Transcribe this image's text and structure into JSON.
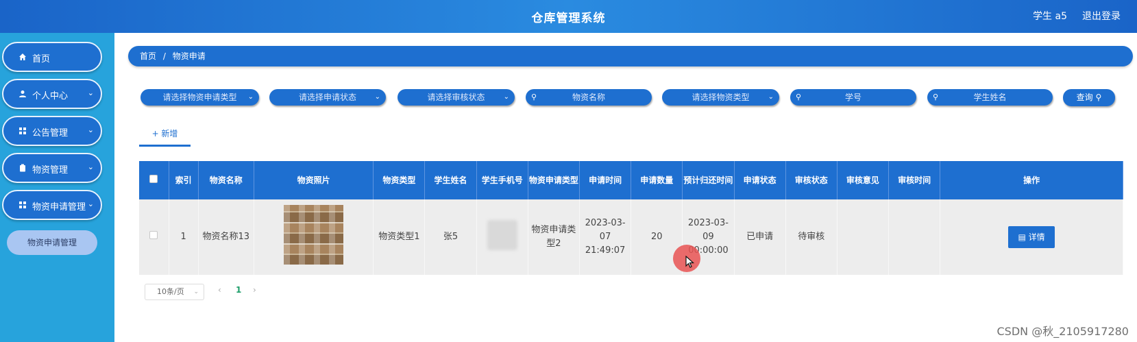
{
  "header": {
    "title": "仓库管理系统",
    "user": "学生 a5",
    "logout": "退出登录"
  },
  "sidebar": {
    "items": [
      {
        "label": "首页",
        "icon": "home-icon",
        "chevron": ""
      },
      {
        "label": "个人中心",
        "icon": "user-icon",
        "chevron": "⌄"
      },
      {
        "label": "公告管理",
        "icon": "grid-icon",
        "chevron": "⌄"
      },
      {
        "label": "物资管理",
        "icon": "clipboard-icon",
        "chevron": "⌄"
      },
      {
        "label": "物资申请管理",
        "icon": "grid-icon",
        "chevron": "⌄"
      }
    ],
    "sub_item": "物资申请管理"
  },
  "breadcrumb": {
    "home": "首页",
    "sep": "/",
    "current": "物资申请"
  },
  "filters": {
    "apply_type": "请选择物资申请类型",
    "apply_status": "请选择申请状态",
    "review_status": "请选择审核状态",
    "item_name": "物资名称",
    "item_type": "请选择物资类型",
    "student_no": "学号",
    "student_name": "学生姓名",
    "query": "查询"
  },
  "add_button": "+ 新增",
  "table": {
    "headers": [
      "索引",
      "物资名称",
      "物资照片",
      "物资类型",
      "学生姓名",
      "学生手机号",
      "物资申请类型",
      "申请时间",
      "申请数量",
      "预计归还时间",
      "申请状态",
      "审核状态",
      "审核意见",
      "审核时间",
      "操作"
    ],
    "rows": [
      {
        "index": "1",
        "item_name": "物资名称13",
        "item_type": "物资类型1",
        "student_name": "张5",
        "apply_type": "物资申请类型2",
        "apply_time": "2023-03-07 21:49:07",
        "quantity": "20",
        "return_time": "2023-03-09 00:00:00",
        "apply_status": "已申请",
        "review_status": "待审核",
        "review_comment": "",
        "review_time": "",
        "detail_label": "详情"
      }
    ]
  },
  "pagination": {
    "page_size": "10条/页",
    "current_page": "1",
    "prev": "‹",
    "next": "›"
  },
  "watermark": "CSDN @秋_2105917280",
  "colors": {
    "header": "#1a64c8",
    "sidebar": "#27a3dc",
    "accent": "#1e6fd0",
    "active_page": "#1e9e6a"
  }
}
